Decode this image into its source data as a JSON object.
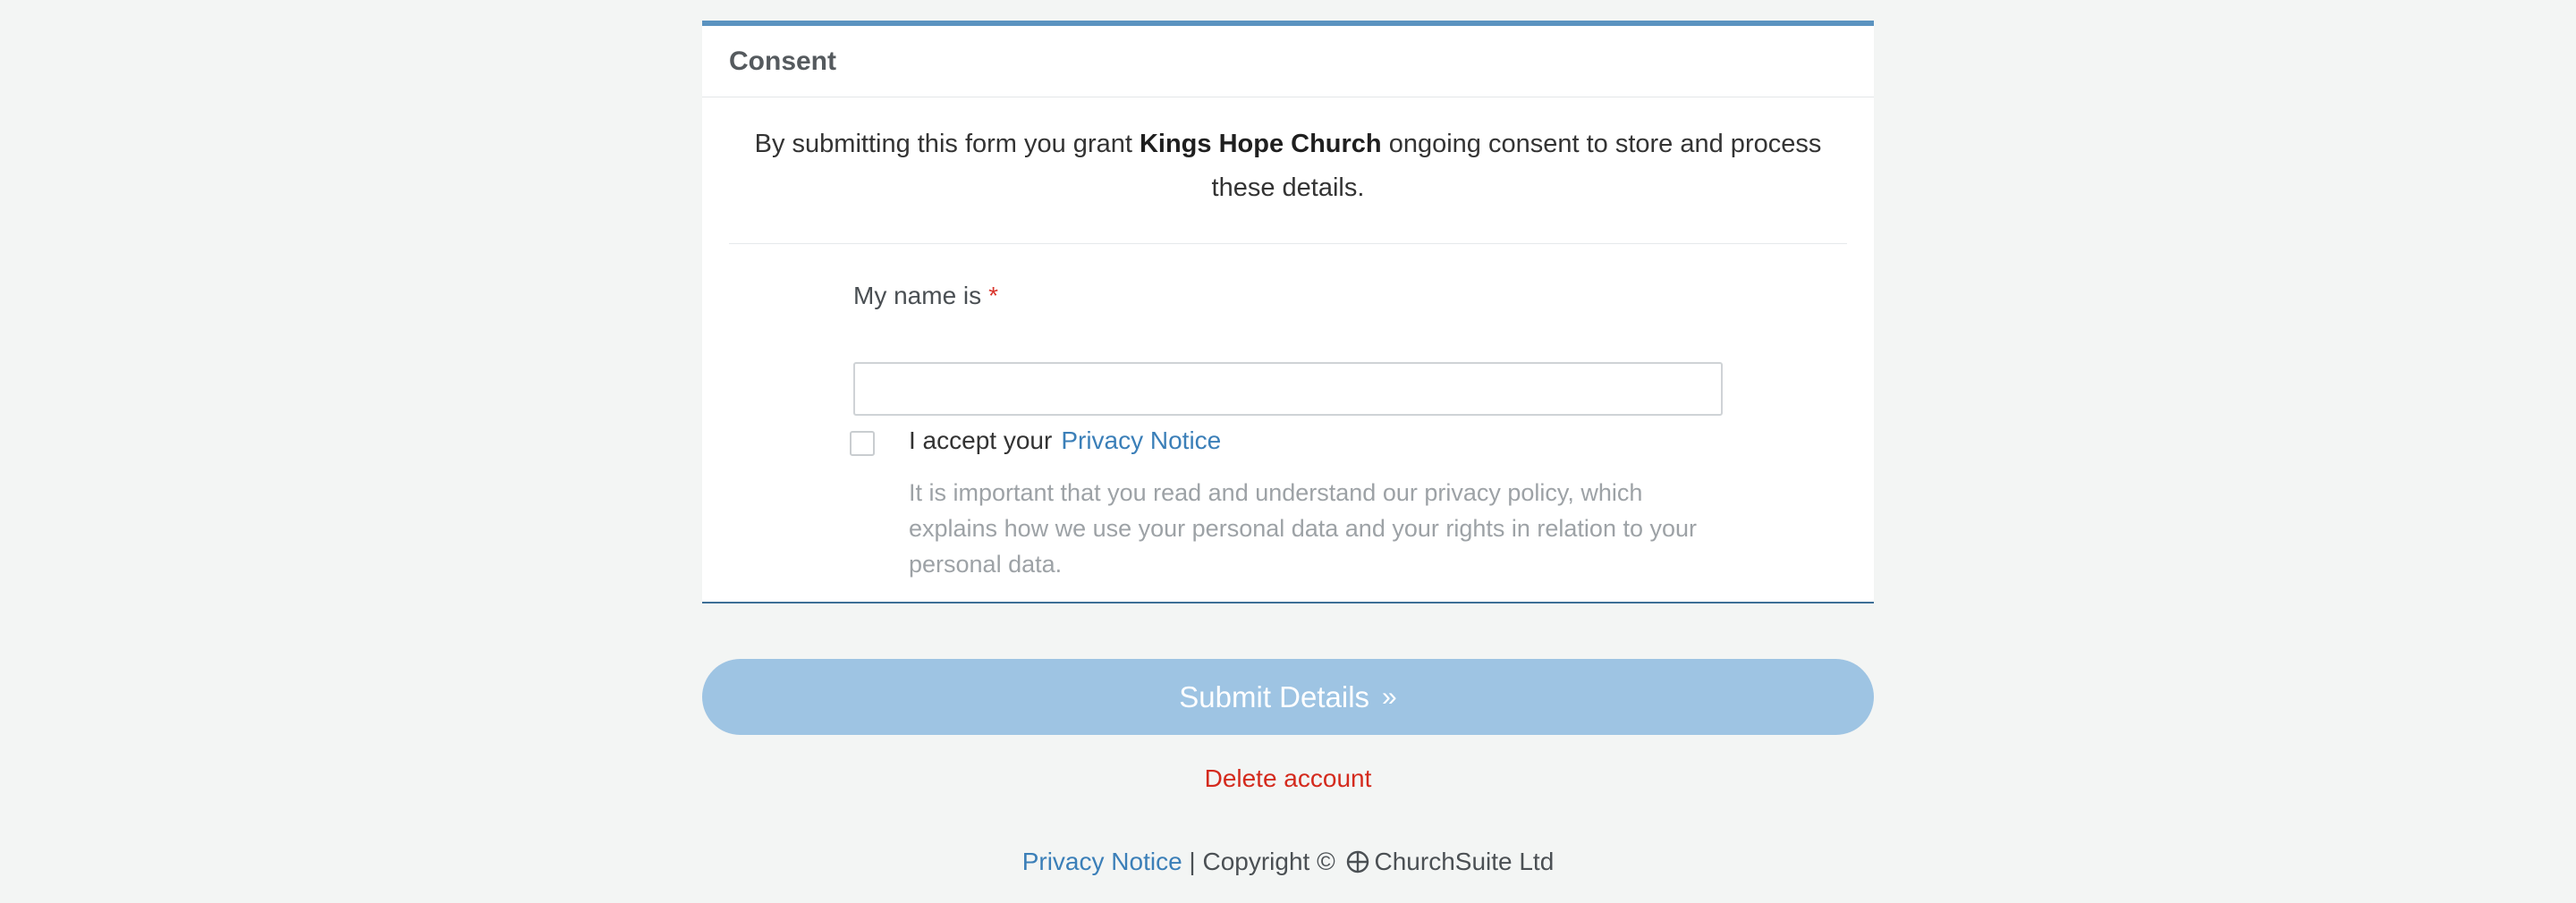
{
  "panel": {
    "title": "Consent",
    "consent_prefix": "By submitting this form you grant ",
    "church_name": "Kings Hope Church",
    "consent_suffix": " ongoing consent to store and process these details."
  },
  "form": {
    "name_label": "My name is",
    "required_marker": "*",
    "name_value": "",
    "accept_text": "I accept your",
    "privacy_link": "Privacy Notice",
    "privacy_help": "It is important that you read and understand our privacy policy, which explains how we use your personal data and your rights in relation to your personal data.",
    "checkbox_checked": false
  },
  "actions": {
    "submit_label": "Submit Details",
    "submit_icon": "chevron-double-right-icon",
    "delete_label": "Delete account"
  },
  "footer": {
    "privacy_link": "Privacy Notice",
    "separator": " | Copyright © ",
    "company": "ChurchSuite Ltd",
    "logo_icon": "churchsuite-logo-icon"
  },
  "colors": {
    "accent": "#5b93c0",
    "link": "#3b7fb8",
    "submit_bg": "#9ec4e3",
    "danger": "#d42a1d",
    "required": "#d9342b"
  }
}
